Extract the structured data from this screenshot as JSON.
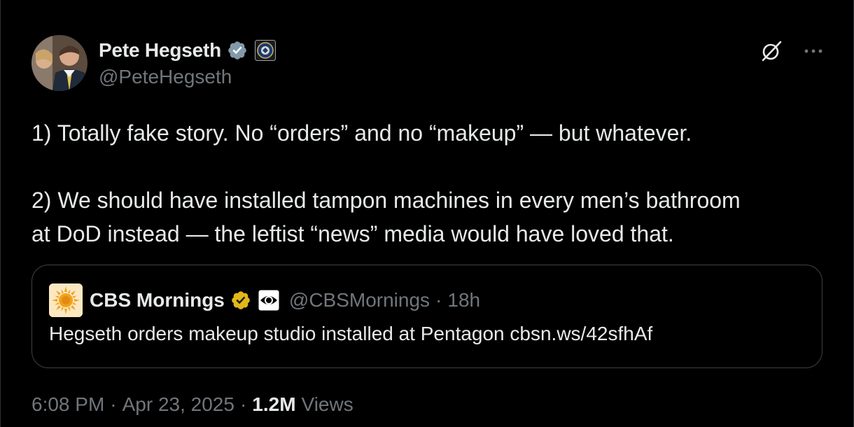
{
  "author": {
    "display_name": "Pete Hegseth",
    "handle": "@PeteHegseth",
    "verified_icon": "verified-badge-icon",
    "affiliation_icon": "dod-seal-icon",
    "colors": {
      "verified": "#829aab"
    }
  },
  "actions": {
    "grok_icon": "grok-icon",
    "more_icon": "more-icon"
  },
  "post": {
    "paragraph_1": "1) Totally fake story. No “orders” and no “makeup” — but whatever.",
    "paragraph_2_line_1": "2) We should have installed tampon machines in every men’s bathroom",
    "paragraph_2_line_2": "at DoD instead — the leftist “news” media would have loved that."
  },
  "quoted_post": {
    "display_name": "CBS Mornings",
    "handle": "@CBSMornings",
    "separator": "·",
    "time_ago": "18h",
    "text": "Hegseth orders makeup studio installed at Pentagon cbsn.ws/42sfhAf",
    "verified_icon": "gold-verified-badge-icon",
    "affiliation_icon": "cbs-eye-icon",
    "colors": {
      "verified": "#e2b719"
    }
  },
  "meta": {
    "time": "6:08 PM",
    "sep1": "·",
    "date": "Apr 23, 2025",
    "sep2": "·",
    "views_count": "1.2M",
    "views_label": "Views"
  },
  "colors": {
    "background": "#000000",
    "text_primary": "#e7e9ea",
    "text_secondary": "#71767b",
    "border": "#3e4144"
  }
}
